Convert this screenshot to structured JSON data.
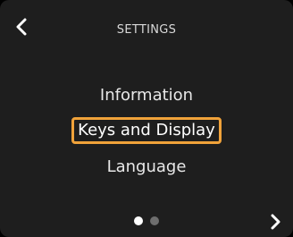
{
  "header": {
    "title": "SETTINGS",
    "back_icon": "chevron-left-icon"
  },
  "menu": {
    "items": [
      {
        "label": "Information",
        "selected": false
      },
      {
        "label": "Keys and Display",
        "selected": true
      },
      {
        "label": "Language",
        "selected": false
      }
    ]
  },
  "pager": {
    "pages": 2,
    "current": 1
  },
  "footer": {
    "next_icon": "chevron-right-icon"
  },
  "colors": {
    "background": "#1e1e1e",
    "selection_border": "#f0a23a",
    "text": "#e8e8e8",
    "dot_active": "#ffffff",
    "dot_inactive": "#6e6e6e"
  }
}
